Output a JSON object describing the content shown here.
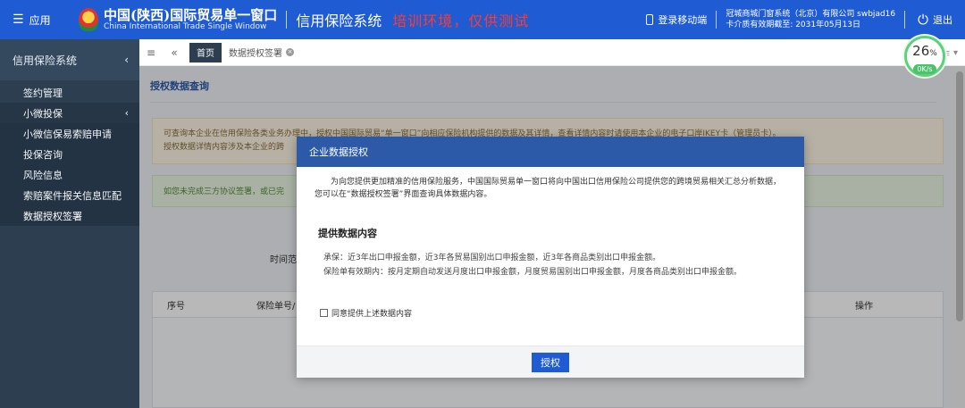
{
  "header": {
    "apps_label": "应用",
    "logo_cn": "中国(陕西)国际贸易单一窗口",
    "logo_en": "China International Trade Single Window",
    "system_name": "信用保险系统",
    "env_warning": "培训环境，仅供测试",
    "mobile_login": "登录移动端",
    "user_line1": "冠城商城门窗系统（北京）有限公司 swbjad16",
    "user_line2": "卡介质有效期截至: 2031年05月13日",
    "logout": "退出"
  },
  "sidebar": {
    "title": "信用保险系统",
    "items": [
      {
        "label": "签约管理"
      },
      {
        "label": "小微投保"
      },
      {
        "label": "小微信保易索赔申请"
      },
      {
        "label": "投保咨询"
      },
      {
        "label": "风险信息"
      },
      {
        "label": "索赔案件报关信息匹配"
      },
      {
        "label": "数据授权签署"
      }
    ]
  },
  "tabs": {
    "home": "首页",
    "current": "数据授权签署",
    "right": "作"
  },
  "gauge": {
    "percent": "26",
    "percent_unit": "%",
    "speed": "0K/s"
  },
  "main": {
    "panel_title": "授权数据查询",
    "notice_line1": "可查询本企业在信用保险各类业务办理中，授权中国国际贸易“单一窗口”向相应保险机构提供的数据及其详情，查看详情内容时请使用本企业的电子口岸IKEY卡（管理员卡）。",
    "notice_line2": "授权数据详情内容涉及本企业的跨",
    "notice2": "如您未完成三方协议签署，或已完",
    "time_label": "时间范",
    "col_index": "序号",
    "col_policy": "保险单号/",
    "col_action": "操作"
  },
  "modal": {
    "title": "企业数据授权",
    "intro": "为向您提供更加精准的信用保险服务，中国国际贸易单一窗口将向中国出口信用保险公司提供您的跨境贸易相关汇总分析数据，您可以在“数据授权签署”界面查询具体数据内容。",
    "section_title": "提供数据内容",
    "line1": "承保：近3年出口申报金额，近3年各贸易国别出口申报金额，近3年各商品类别出口申报金额。",
    "line2": "保险单有效期内：按月定期自动发送月度出口申报金额，月度贸易国别出口申报金额，月度各商品类别出口申报金额。",
    "agree_label": "同意提供上述数据内容",
    "authorize_button": "授权"
  }
}
